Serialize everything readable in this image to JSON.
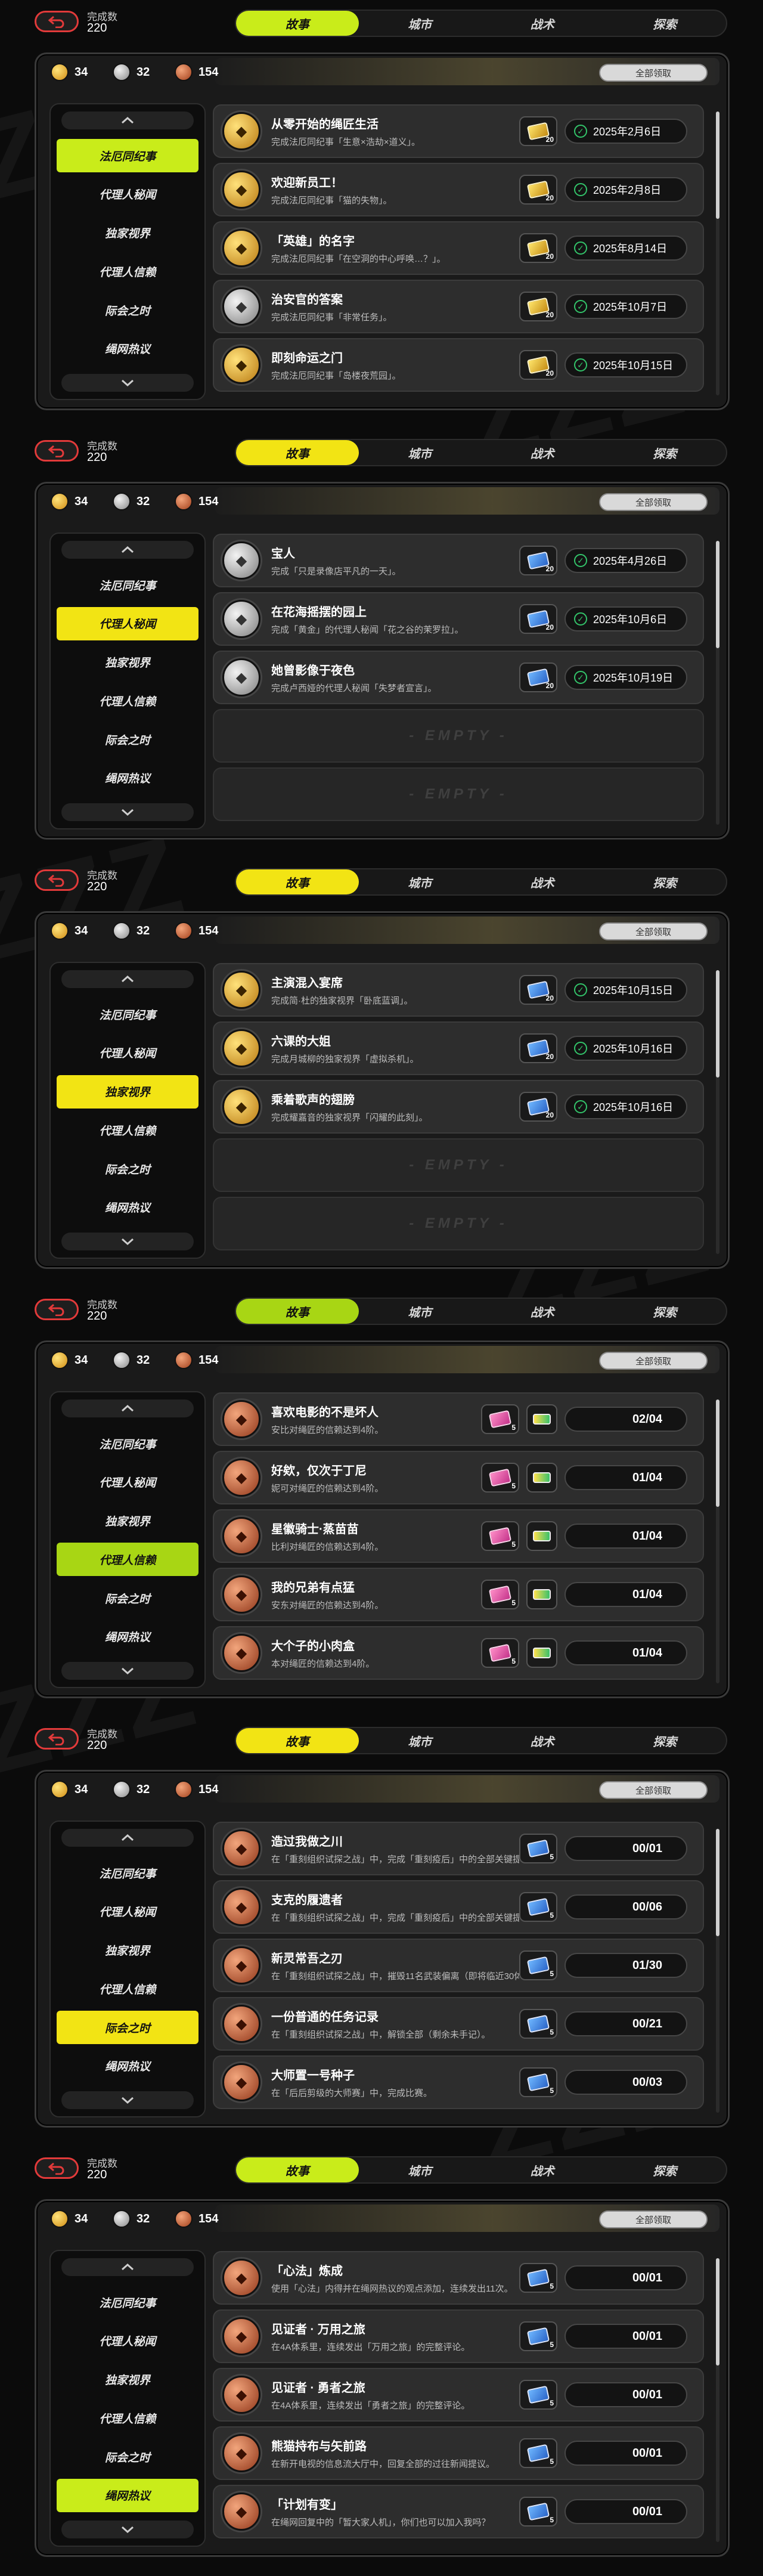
{
  "accent": "#d9f014",
  "header": {
    "done_label": "完成数",
    "done_value": "220"
  },
  "tabs": [
    "故事",
    "城市",
    "战术",
    "探索"
  ],
  "currency": {
    "gold": "34",
    "silver": "32",
    "bronze": "154"
  },
  "claim_all": "全部领取",
  "nav_items": [
    "法厄同纪事",
    "代理人秘闻",
    "独家视界",
    "代理人信赖",
    "际会之时",
    "绳网热议"
  ],
  "empty_label": "- EMPTY -",
  "panels": [
    {
      "active_tab": 0,
      "active_nav": 0,
      "accent": "#c9ec1a",
      "rows": [
        {
          "medal": "gold",
          "title": "从零开始的绳匠生活",
          "desc": "完成法厄同纪事「生意×浩劫×道义」。",
          "reward": "y",
          "reward_qty": "20",
          "status": "2025年2月6日"
        },
        {
          "medal": "gold",
          "title": "欢迎新员工！",
          "desc": "完成法厄同纪事「猫的失物」。",
          "reward": "y",
          "reward_qty": "20",
          "status": "2025年2月8日"
        },
        {
          "medal": "gold",
          "title": "「英雄」的名字",
          "desc": "完成法厄同纪事「在空洞的中心呼唤…？」。",
          "reward": "y",
          "reward_qty": "20",
          "status": "2025年8月14日"
        },
        {
          "medal": "silver",
          "title": "治安官的答案",
          "desc": "完成法厄同纪事「非常任务」。",
          "reward": "y",
          "reward_qty": "20",
          "status": "2025年10月7日"
        },
        {
          "medal": "gold",
          "title": "即刻命运之门",
          "desc": "完成法厄同纪事「岛楼夜荒园」。",
          "reward": "y",
          "reward_qty": "20",
          "status": "2025年10月15日"
        }
      ]
    },
    {
      "active_tab": 0,
      "active_nav": 1,
      "accent": "#f2e414",
      "rows": [
        {
          "medal": "silver",
          "title": "宝人",
          "desc": "完成「只是录像店平凡的一天」。",
          "reward": "b",
          "reward_qty": "20",
          "status": "2025年4月26日"
        },
        {
          "medal": "silver",
          "title": "在花海摇摆的园上",
          "desc": "完成「黄金」的代理人秘闻「花之谷的茉罗拉」。",
          "reward": "b",
          "reward_qty": "20",
          "status": "2025年10月6日"
        },
        {
          "medal": "silver",
          "title": "她曾影像于夜色",
          "desc": "完成卢西娅的代理人秘闻「失梦者宣言」。",
          "reward": "b",
          "reward_qty": "20",
          "status": "2025年10月19日"
        },
        {
          "empty": true
        },
        {
          "empty": true
        }
      ]
    },
    {
      "active_tab": 0,
      "active_nav": 2,
      "accent": "#f2e414",
      "rows": [
        {
          "medal": "gold",
          "title": "主演混入宴席",
          "desc": "完成简·杜的独家视界「卧底蓝调」。",
          "reward": "b",
          "reward_qty": "20",
          "status": "2025年10月15日"
        },
        {
          "medal": "gold",
          "title": "六课的大姐",
          "desc": "完成月城柳的独家视界「虚拟杀机」。",
          "reward": "b",
          "reward_qty": "20",
          "status": "2025年10月16日"
        },
        {
          "medal": "gold",
          "title": "乘着歌声的翅膀",
          "desc": "完成耀嘉音的独家视界「闪耀的此刻」。",
          "reward": "b",
          "reward_qty": "20",
          "status": "2025年10月16日"
        },
        {
          "empty": true
        },
        {
          "empty": true
        }
      ]
    },
    {
      "active_tab": 0,
      "active_nav": 3,
      "accent": "#a8d614",
      "rows": [
        {
          "medal": "bronze",
          "title": "喜欢电影的不是坏人",
          "desc": "安比对绳匠的信赖达到4阶。",
          "reward": "p",
          "reward_qty": "5",
          "reward2": true,
          "progress": "02/04"
        },
        {
          "medal": "bronze",
          "title": "好欸，仅次于丁尼",
          "desc": "妮可对绳匠的信赖达到4阶。",
          "reward": "p",
          "reward_qty": "5",
          "reward2": true,
          "progress": "01/04"
        },
        {
          "medal": "bronze",
          "title": "星徽骑士·蒸苗苗",
          "desc": "比利对绳匠的信赖达到4阶。",
          "reward": "p",
          "reward_qty": "5",
          "reward2": true,
          "progress": "01/04"
        },
        {
          "medal": "bronze",
          "title": "我的兄弟有点猛",
          "desc": "安东对绳匠的信赖达到4阶。",
          "reward": "p",
          "reward_qty": "5",
          "reward2": true,
          "progress": "01/04"
        },
        {
          "medal": "bronze",
          "title": "大个子的小肉盒",
          "desc": "本对绳匠的信赖达到4阶。",
          "reward": "p",
          "reward_qty": "5",
          "reward2": true,
          "progress": "01/04"
        }
      ]
    },
    {
      "active_tab": 0,
      "active_nav": 4,
      "accent": "#f2e414",
      "rows": [
        {
          "medal": "bronze",
          "title": "造过我做之川",
          "desc": "在「重刻组织试探之战」中，完成「重刻疫后」中的全部关键提议。",
          "reward": "b",
          "reward_qty": "5",
          "progress": "00/01"
        },
        {
          "medal": "bronze",
          "title": "支克的履遗者",
          "desc": "在「重刻组织试探之战」中，完成「重刻疫后」中的全部关键提议。",
          "reward": "b",
          "reward_qty": "5",
          "progress": "00/06"
        },
        {
          "medal": "bronze",
          "title": "新灵常吾之刃",
          "desc": "在「重刻组织试探之战」中，摧毁11名武装偏离（即将临近30体）。",
          "reward": "b",
          "reward_qty": "5",
          "progress": "01/30"
        },
        {
          "medal": "bronze",
          "title": "一份普通的任务记录",
          "desc": "在「重刻组织试探之战」中，解锁全部（剩余未手记）。",
          "reward": "b",
          "reward_qty": "5",
          "progress": "00/21"
        },
        {
          "medal": "bronze",
          "title": "大师置一号种子",
          "desc": "在「后后剪级的大师赛」中，完成比赛。",
          "reward": "b",
          "reward_qty": "5",
          "progress": "00/03"
        }
      ]
    },
    {
      "active_tab": 0,
      "active_nav": 5,
      "accent": "#c9ec1a",
      "rows": [
        {
          "medal": "bronze",
          "title": "「心法」炼成",
          "desc": "使用「心法」内得并在绳网热议的观点添加，连续发出11次。",
          "reward": "b",
          "reward_qty": "5",
          "progress": "00/01"
        },
        {
          "medal": "bronze",
          "title": "见证者 · 万用之旅",
          "desc": "在4A体系里，连续发出「万用之旅」的完整评论。",
          "reward": "b",
          "reward_qty": "5",
          "progress": "00/01"
        },
        {
          "medal": "bronze",
          "title": "见证者 · 勇者之旅",
          "desc": "在4A体系里，连续发出「勇者之旅」的完整评论。",
          "reward": "b",
          "reward_qty": "5",
          "progress": "00/01"
        },
        {
          "medal": "bronze",
          "title": "熊猫持布与矢前路",
          "desc": "在新开电视的信息流大厅中，回复全部的过往新闻提议。",
          "reward": "b",
          "reward_qty": "5",
          "progress": "00/01"
        },
        {
          "medal": "bronze",
          "title": "「计划有变」",
          "desc": "在绳网回复中的「暂大家人机」，你们也可以加入我吗？",
          "reward": "b",
          "reward_qty": "5",
          "progress": "00/01"
        }
      ]
    }
  ]
}
